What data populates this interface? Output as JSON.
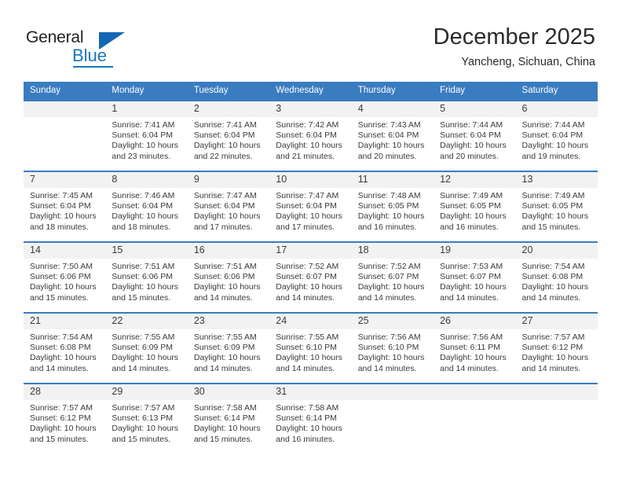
{
  "brand": {
    "name_part1": "General",
    "name_part2": "Blue",
    "accent_color": "#1b75bc",
    "triangle_color": "#1268b3"
  },
  "header": {
    "month_title": "December 2025",
    "location": "Yancheng, Sichuan, China"
  },
  "calendar": {
    "header_color": "#3a7cc0",
    "weekday_headers": [
      "Sunday",
      "Monday",
      "Tuesday",
      "Wednesday",
      "Thursday",
      "Friday",
      "Saturday"
    ],
    "weeks": [
      [
        {
          "day": "",
          "sunrise": "",
          "sunset": "",
          "daylight1": "",
          "daylight2": ""
        },
        {
          "day": "1",
          "sunrise": "Sunrise: 7:41 AM",
          "sunset": "Sunset: 6:04 PM",
          "daylight1": "Daylight: 10 hours",
          "daylight2": "and 23 minutes."
        },
        {
          "day": "2",
          "sunrise": "Sunrise: 7:41 AM",
          "sunset": "Sunset: 6:04 PM",
          "daylight1": "Daylight: 10 hours",
          "daylight2": "and 22 minutes."
        },
        {
          "day": "3",
          "sunrise": "Sunrise: 7:42 AM",
          "sunset": "Sunset: 6:04 PM",
          "daylight1": "Daylight: 10 hours",
          "daylight2": "and 21 minutes."
        },
        {
          "day": "4",
          "sunrise": "Sunrise: 7:43 AM",
          "sunset": "Sunset: 6:04 PM",
          "daylight1": "Daylight: 10 hours",
          "daylight2": "and 20 minutes."
        },
        {
          "day": "5",
          "sunrise": "Sunrise: 7:44 AM",
          "sunset": "Sunset: 6:04 PM",
          "daylight1": "Daylight: 10 hours",
          "daylight2": "and 20 minutes."
        },
        {
          "day": "6",
          "sunrise": "Sunrise: 7:44 AM",
          "sunset": "Sunset: 6:04 PM",
          "daylight1": "Daylight: 10 hours",
          "daylight2": "and 19 minutes."
        }
      ],
      [
        {
          "day": "7",
          "sunrise": "Sunrise: 7:45 AM",
          "sunset": "Sunset: 6:04 PM",
          "daylight1": "Daylight: 10 hours",
          "daylight2": "and 18 minutes."
        },
        {
          "day": "8",
          "sunrise": "Sunrise: 7:46 AM",
          "sunset": "Sunset: 6:04 PM",
          "daylight1": "Daylight: 10 hours",
          "daylight2": "and 18 minutes."
        },
        {
          "day": "9",
          "sunrise": "Sunrise: 7:47 AM",
          "sunset": "Sunset: 6:04 PM",
          "daylight1": "Daylight: 10 hours",
          "daylight2": "and 17 minutes."
        },
        {
          "day": "10",
          "sunrise": "Sunrise: 7:47 AM",
          "sunset": "Sunset: 6:04 PM",
          "daylight1": "Daylight: 10 hours",
          "daylight2": "and 17 minutes."
        },
        {
          "day": "11",
          "sunrise": "Sunrise: 7:48 AM",
          "sunset": "Sunset: 6:05 PM",
          "daylight1": "Daylight: 10 hours",
          "daylight2": "and 16 minutes."
        },
        {
          "day": "12",
          "sunrise": "Sunrise: 7:49 AM",
          "sunset": "Sunset: 6:05 PM",
          "daylight1": "Daylight: 10 hours",
          "daylight2": "and 16 minutes."
        },
        {
          "day": "13",
          "sunrise": "Sunrise: 7:49 AM",
          "sunset": "Sunset: 6:05 PM",
          "daylight1": "Daylight: 10 hours",
          "daylight2": "and 15 minutes."
        }
      ],
      [
        {
          "day": "14",
          "sunrise": "Sunrise: 7:50 AM",
          "sunset": "Sunset: 6:06 PM",
          "daylight1": "Daylight: 10 hours",
          "daylight2": "and 15 minutes."
        },
        {
          "day": "15",
          "sunrise": "Sunrise: 7:51 AM",
          "sunset": "Sunset: 6:06 PM",
          "daylight1": "Daylight: 10 hours",
          "daylight2": "and 15 minutes."
        },
        {
          "day": "16",
          "sunrise": "Sunrise: 7:51 AM",
          "sunset": "Sunset: 6:06 PM",
          "daylight1": "Daylight: 10 hours",
          "daylight2": "and 14 minutes."
        },
        {
          "day": "17",
          "sunrise": "Sunrise: 7:52 AM",
          "sunset": "Sunset: 6:07 PM",
          "daylight1": "Daylight: 10 hours",
          "daylight2": "and 14 minutes."
        },
        {
          "day": "18",
          "sunrise": "Sunrise: 7:52 AM",
          "sunset": "Sunset: 6:07 PM",
          "daylight1": "Daylight: 10 hours",
          "daylight2": "and 14 minutes."
        },
        {
          "day": "19",
          "sunrise": "Sunrise: 7:53 AM",
          "sunset": "Sunset: 6:07 PM",
          "daylight1": "Daylight: 10 hours",
          "daylight2": "and 14 minutes."
        },
        {
          "day": "20",
          "sunrise": "Sunrise: 7:54 AM",
          "sunset": "Sunset: 6:08 PM",
          "daylight1": "Daylight: 10 hours",
          "daylight2": "and 14 minutes."
        }
      ],
      [
        {
          "day": "21",
          "sunrise": "Sunrise: 7:54 AM",
          "sunset": "Sunset: 6:08 PM",
          "daylight1": "Daylight: 10 hours",
          "daylight2": "and 14 minutes."
        },
        {
          "day": "22",
          "sunrise": "Sunrise: 7:55 AM",
          "sunset": "Sunset: 6:09 PM",
          "daylight1": "Daylight: 10 hours",
          "daylight2": "and 14 minutes."
        },
        {
          "day": "23",
          "sunrise": "Sunrise: 7:55 AM",
          "sunset": "Sunset: 6:09 PM",
          "daylight1": "Daylight: 10 hours",
          "daylight2": "and 14 minutes."
        },
        {
          "day": "24",
          "sunrise": "Sunrise: 7:55 AM",
          "sunset": "Sunset: 6:10 PM",
          "daylight1": "Daylight: 10 hours",
          "daylight2": "and 14 minutes."
        },
        {
          "day": "25",
          "sunrise": "Sunrise: 7:56 AM",
          "sunset": "Sunset: 6:10 PM",
          "daylight1": "Daylight: 10 hours",
          "daylight2": "and 14 minutes."
        },
        {
          "day": "26",
          "sunrise": "Sunrise: 7:56 AM",
          "sunset": "Sunset: 6:11 PM",
          "daylight1": "Daylight: 10 hours",
          "daylight2": "and 14 minutes."
        },
        {
          "day": "27",
          "sunrise": "Sunrise: 7:57 AM",
          "sunset": "Sunset: 6:12 PM",
          "daylight1": "Daylight: 10 hours",
          "daylight2": "and 14 minutes."
        }
      ],
      [
        {
          "day": "28",
          "sunrise": "Sunrise: 7:57 AM",
          "sunset": "Sunset: 6:12 PM",
          "daylight1": "Daylight: 10 hours",
          "daylight2": "and 15 minutes."
        },
        {
          "day": "29",
          "sunrise": "Sunrise: 7:57 AM",
          "sunset": "Sunset: 6:13 PM",
          "daylight1": "Daylight: 10 hours",
          "daylight2": "and 15 minutes."
        },
        {
          "day": "30",
          "sunrise": "Sunrise: 7:58 AM",
          "sunset": "Sunset: 6:14 PM",
          "daylight1": "Daylight: 10 hours",
          "daylight2": "and 15 minutes."
        },
        {
          "day": "31",
          "sunrise": "Sunrise: 7:58 AM",
          "sunset": "Sunset: 6:14 PM",
          "daylight1": "Daylight: 10 hours",
          "daylight2": "and 16 minutes."
        },
        {
          "day": "",
          "sunrise": "",
          "sunset": "",
          "daylight1": "",
          "daylight2": ""
        },
        {
          "day": "",
          "sunrise": "",
          "sunset": "",
          "daylight1": "",
          "daylight2": ""
        },
        {
          "day": "",
          "sunrise": "",
          "sunset": "",
          "daylight1": "",
          "daylight2": ""
        }
      ]
    ]
  }
}
